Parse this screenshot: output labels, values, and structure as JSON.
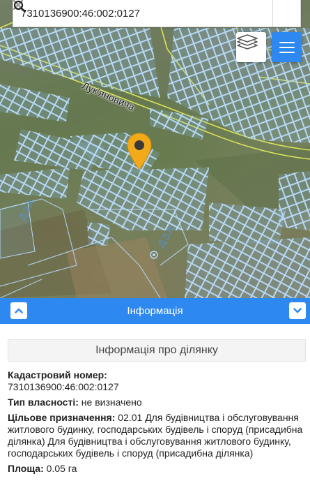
{
  "search": {
    "value": "7310136900:46:002:0127",
    "placeholder": ""
  },
  "icons": {
    "clear": "close-icon",
    "search": "search-icon",
    "layers": "layers-icon",
    "menu": "hamburger-menu-icon",
    "pin": "map-pin-icon",
    "collapse_up": "chevron-up-icon",
    "collapse_down": "chevron-down-icon"
  },
  "map": {
    "street_label": "Лук'яновича",
    "zone_label_1": "ДЗА",
    "zone_label_2": "ДЗА"
  },
  "colors": {
    "accent": "#2d88f0",
    "pin": "#f2a91a",
    "parcel_outline": "#a9cdf2",
    "road_line": "#e8f05a"
  },
  "info_header": {
    "title": "Інформація"
  },
  "panel": {
    "title": "Інформація про ділянку",
    "cadastral_label": "Кадастровий номер:",
    "cadastral_value": "7310136900:46:002:0127",
    "ownership_label": "Тип власності:",
    "ownership_value": "не визначено",
    "purpose_label": "Цільове призначення:",
    "purpose_value": "02.01 Для будівництва і обслуговування житлового будинку, господарських будівель і споруд (присадибна ділянка) Для будівництва і обслуговування житлового будинку, господарських будівель і споруд (присадибна ділянка)",
    "area_label": "Площа:",
    "area_value": "0.05 га"
  }
}
